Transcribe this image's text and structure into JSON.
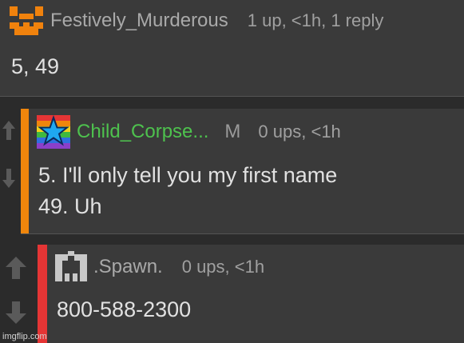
{
  "comments": [
    {
      "username": "Festively_Murderous",
      "meta": "1 up, <1h, 1 reply",
      "lines": [
        "5, 49"
      ],
      "icons": {
        "avatar": "orange-jack-o-lantern-face-icon"
      },
      "colors": {
        "username": "#a9a9a9"
      }
    },
    {
      "username": "Child_Corpse...",
      "mod_badge": "M",
      "meta": "0 ups, <1h",
      "lines": [
        "5. I'll only tell you my first name",
        "49. Uh"
      ],
      "icons": {
        "avatar": "rainbow-star-icon",
        "upvote": "upvote-arrow-icon",
        "downvote": "downvote-arrow-icon"
      },
      "colors": {
        "username": "#4ec24e",
        "accent": "#f0860c"
      }
    },
    {
      "username": ".Spawn.",
      "meta": "0 ups, <1h",
      "lines": [
        "800-588-2300"
      ],
      "icons": {
        "avatar": "pixel-robot-icon",
        "upvote": "upvote-arrow-icon",
        "downvote": "downvote-arrow-icon"
      },
      "colors": {
        "username": "#a9a9a9",
        "accent": "#e53535"
      }
    }
  ],
  "watermark": "imgflip.com"
}
